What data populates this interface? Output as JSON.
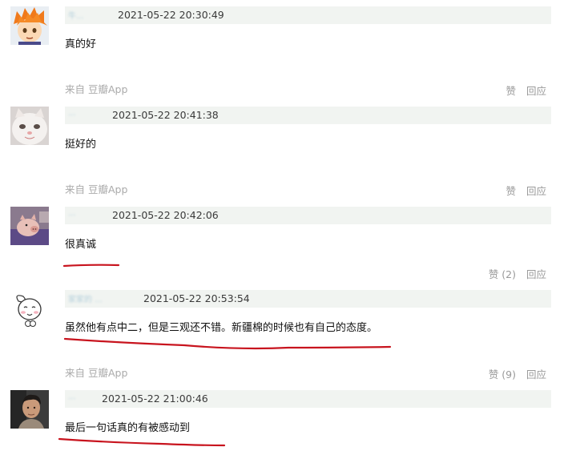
{
  "comments": [
    {
      "username": "牛...",
      "time": "2021-05-22 20:30:49",
      "text": "真的好",
      "source": "来自 豆瓣App",
      "like_label": "赞",
      "reply_label": "回应",
      "avatar": "anime-orange-hair-boy"
    },
    {
      "username": "...",
      "time": "2021-05-22 20:41:38",
      "text": "挺好的",
      "source": "来自 豆瓣App",
      "like_label": "赞",
      "reply_label": "回应",
      "avatar": "white-cat-face"
    },
    {
      "username": "...",
      "time": "2021-05-22 20:42:06",
      "text": "很真诚",
      "source": "",
      "like_label": "赞 (2)",
      "reply_label": "回应",
      "avatar": "pig-on-purple-blanket"
    },
    {
      "username": "家家的 ...",
      "time": "2021-05-22 20:53:54",
      "text": "虽然他有点中二，但是三观还不错。新疆棉的时候也有自己的态度。",
      "source": "来自 豆瓣App",
      "like_label": "赞 (9)",
      "reply_label": "回应",
      "avatar": "cartoon-white-bunny"
    },
    {
      "username": "...",
      "time": "2021-05-22 21:00:46",
      "text": "最后一句话真的有被感动到",
      "source": "",
      "like_label": "",
      "reply_label": "",
      "avatar": "young-man-portrait"
    }
  ],
  "colors": {
    "meta_bar": "#f1f4f1",
    "underline": "#c8141e",
    "muted_text": "#999999"
  }
}
